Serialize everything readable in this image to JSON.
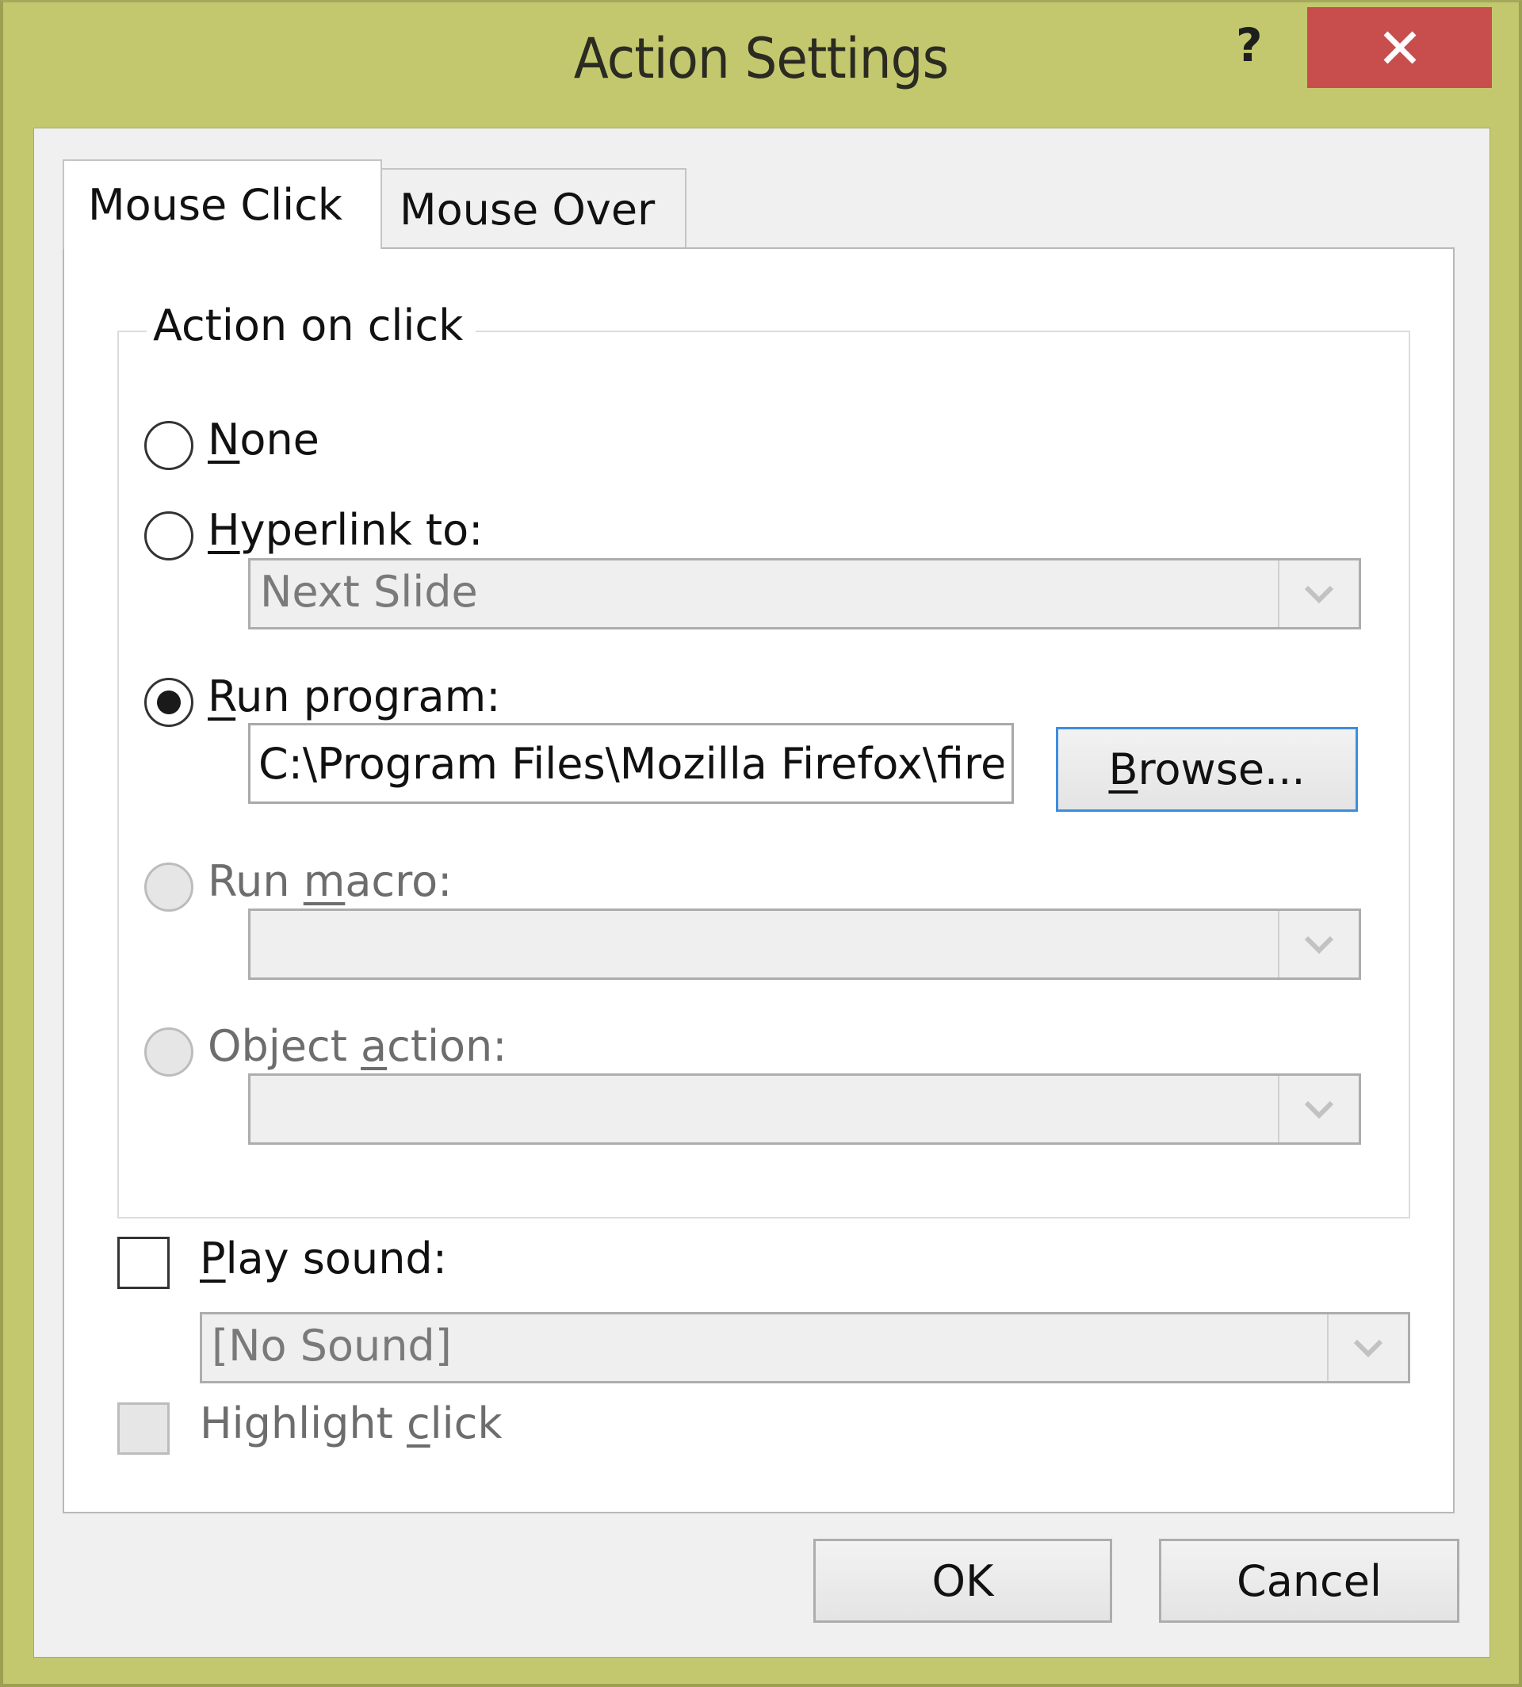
{
  "window": {
    "title": "Action Settings",
    "help_label": "?",
    "close_icon": "close-icon",
    "frame_color": "#c3c86e",
    "close_color": "#c84e4e"
  },
  "tabs": [
    {
      "label": "Mouse Click",
      "active": true
    },
    {
      "label": "Mouse Over",
      "active": false
    }
  ],
  "group": {
    "legend": "Action on click",
    "options": {
      "none": {
        "pre": "",
        "key": "N",
        "post": "one",
        "selected": false,
        "enabled": true
      },
      "hyperlink": {
        "pre": "",
        "key": "H",
        "post": "yperlink to:",
        "selected": false,
        "enabled": true
      },
      "run_program": {
        "pre": "",
        "key": "R",
        "post": "un program:",
        "selected": true,
        "enabled": true
      },
      "run_macro": {
        "pre": "Run ",
        "key": "m",
        "post": "acro:",
        "selected": false,
        "enabled": false
      },
      "object_action": {
        "pre": "Object ",
        "key": "a",
        "post": "ction:",
        "selected": false,
        "enabled": false
      }
    },
    "hyperlink_combo": {
      "value": "Next Slide",
      "enabled": false
    },
    "program_path": {
      "value": "C:\\Program Files\\Mozilla Firefox\\fire"
    },
    "browse": {
      "pre": "",
      "key": "B",
      "post": "rowse..."
    },
    "macro_combo": {
      "value": "",
      "enabled": false
    },
    "object_combo": {
      "value": "",
      "enabled": false
    }
  },
  "play_sound": {
    "pre": "",
    "key": "P",
    "post": "lay sound:",
    "checked": false,
    "enabled": true
  },
  "sound_combo": {
    "value": "[No Sound]",
    "enabled": false
  },
  "highlight_click": {
    "pre": "Highlight ",
    "key": "c",
    "post": "lick",
    "checked": false,
    "enabled": false
  },
  "buttons": {
    "ok": "OK",
    "cancel": "Cancel"
  }
}
